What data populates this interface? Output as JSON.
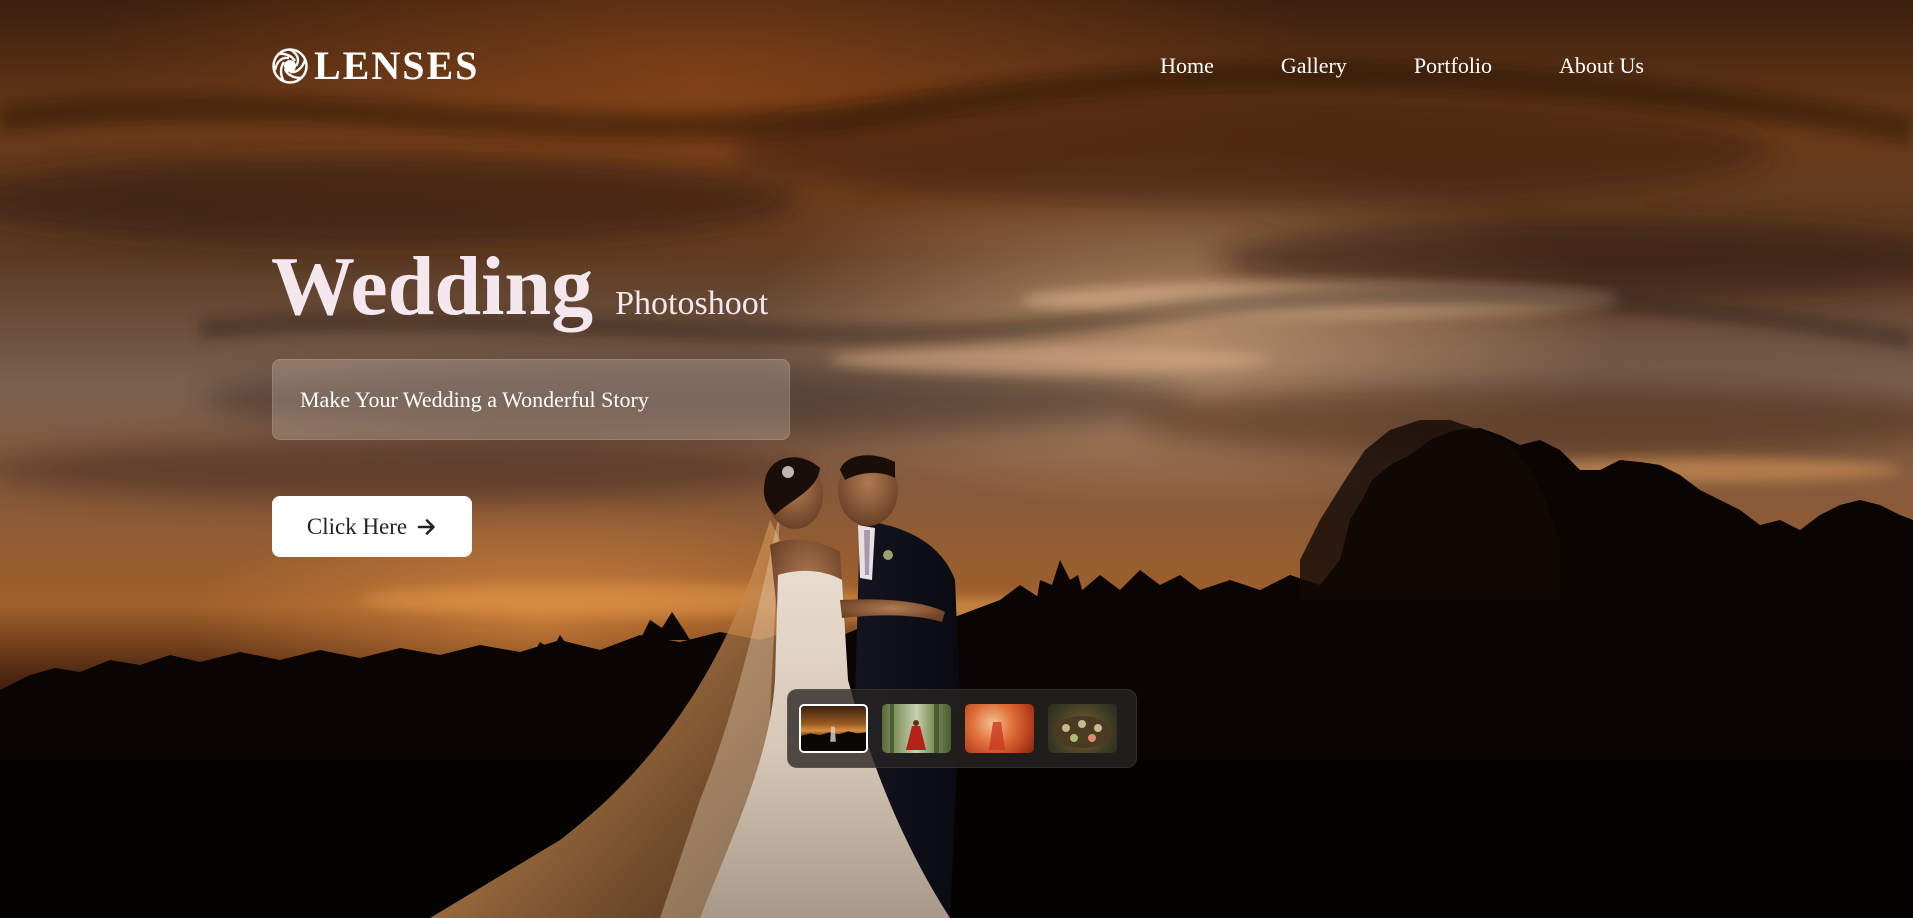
{
  "brand": {
    "logo_icon": "aperture-icon",
    "name": "LENSES"
  },
  "nav": {
    "items": [
      {
        "label": "Home"
      },
      {
        "label": "Gallery"
      },
      {
        "label": "Portfolio"
      },
      {
        "label": "About Us"
      }
    ]
  },
  "hero": {
    "title": "Wedding",
    "subtitle": "Photoshoot",
    "tagline": "Make Your Wedding a Wonderful Story",
    "cta_label": "Click Here",
    "cta_icon": "arrow-right-icon"
  },
  "thumbnails": {
    "selected_index": 0,
    "items": [
      {
        "name": "sunset-couple-thumbnail"
      },
      {
        "name": "forest-red-dress-thumbnail"
      },
      {
        "name": "orange-haze-thumbnail"
      },
      {
        "name": "table-setting-thumbnail"
      }
    ]
  },
  "colors": {
    "text_primary": "#ffffff",
    "headline": "#f4e8ee",
    "button_bg": "#ffffff",
    "button_text": "#222222",
    "thumb_strip_bg": "#28242 2c"
  }
}
